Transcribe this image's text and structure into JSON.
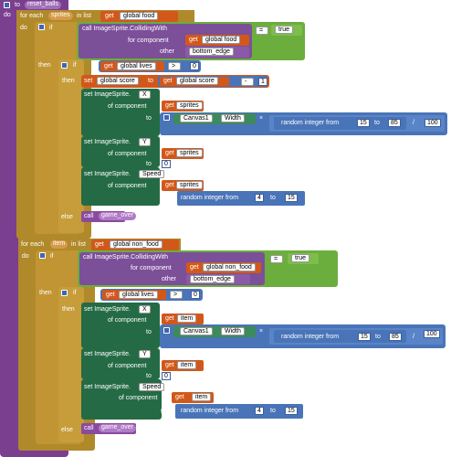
{
  "proc": {
    "to": "to",
    "name": "reset_balls",
    "do": "do"
  },
  "loop1": {
    "for_each": "for each",
    "var": "sprites",
    "in_list": "in list",
    "get": "get",
    "list": "global food",
    "do": "do",
    "if": "if",
    "call": "call ImageSprite.CollidingWith",
    "for_component": "for component",
    "comp_val": "global food",
    "other": "other",
    "other_val": "bottom_edge",
    "eq": "=",
    "true": "true",
    "then": "then",
    "if2": "if",
    "get_lives": "global lives",
    "gt": ">",
    "zero": "0",
    "then2": "then",
    "set": "set",
    "score": "global score",
    "to": "to",
    "minus": "-",
    "one": "1",
    "set_x": "set ImageSprite.",
    "prop_x": "X",
    "of_component": "of component",
    "sprites": "sprites",
    "canvas": "Canvas1",
    "width": "Width",
    "times": "×",
    "random": "random integer from",
    "r1a": "15",
    "r1to": "to",
    "r1b": "85",
    "div": "/",
    "hundred": "100",
    "prop_y": "Y",
    "prop_speed": "Speed",
    "r2a": "4",
    "r2b": "15",
    "else": "else",
    "call_go": "call",
    "game_over": "game_over"
  },
  "loop2": {
    "for_each": "for each",
    "var": "item",
    "in_list": "in list",
    "get": "get",
    "list": "global non_food",
    "do": "do",
    "if": "if",
    "call": "call ImageSprite.CollidingWith",
    "for_component": "for component",
    "comp_val": "global non_food",
    "other": "other",
    "other_val": "bottom_edge",
    "eq": "=",
    "true": "true",
    "then": "then",
    "if2": "if",
    "get_lives": "global lives",
    "gt": ">",
    "zero": "0",
    "then2": "then",
    "set_x": "set ImageSprite.",
    "prop_x": "X",
    "of_component": "of component",
    "item": "item",
    "to": "to",
    "canvas": "Canvas1",
    "width": "Width",
    "times": "×",
    "random": "random integer from",
    "r1a": "15",
    "r1to": "to",
    "r1b": "85",
    "div": "/",
    "hundred": "100",
    "prop_y": "Y",
    "prop_speed": "Speed",
    "r2a": "4",
    "r2b": "15",
    "else": "else",
    "call_go": "call",
    "game_over": "game_over"
  }
}
